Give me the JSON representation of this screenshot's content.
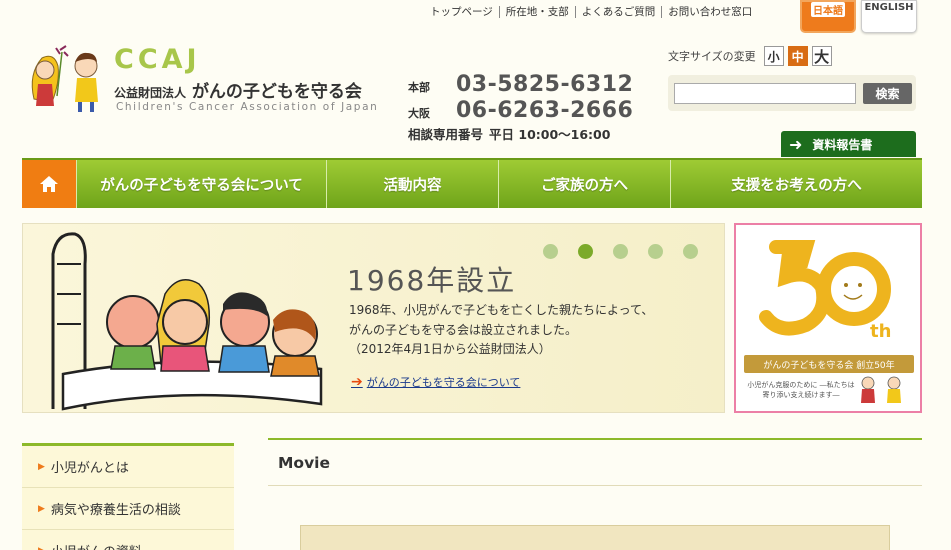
{
  "toplinks": [
    "トップページ",
    "所在地・支部",
    "よくあるご質問",
    "お問い合わせ窓口"
  ],
  "lang": {
    "ja": "日本語",
    "en": "ENGLISH"
  },
  "logo": {
    "ccaj": "CCAJ",
    "org_prefix": "公益財団法人",
    "org_name": "がんの子どもを守る会",
    "english": "Children's Cancer Association of Japan"
  },
  "phones": [
    {
      "label": "本部",
      "number": "03-5825-6312"
    },
    {
      "label": "大阪",
      "number": "06-6263-2666"
    }
  ],
  "hotline": {
    "label": "相談専用番号",
    "hours": "平日 10:00〜16:00"
  },
  "font_size": {
    "label": "文字サイズの変更",
    "small": "小",
    "medium": "中",
    "large": "大"
  },
  "search": {
    "button": "検索",
    "placeholder": ""
  },
  "report_button": "資料報告書",
  "nav": [
    "がんの子どもを守る会について",
    "活動内容",
    "ご家族の方へ",
    "支援をお考えの方へ"
  ],
  "hero": {
    "title": "1968年設立",
    "lines": [
      "1968年、小児がんで子どもを亡くした親たちによって、",
      "がんの子どもを守る会は設立されました。",
      "（2012年4月1日から公益財団法人）"
    ],
    "link": "がんの子どもを守る会について",
    "slides_total": 5,
    "slide_active": 2
  },
  "banner50": {
    "caption": "がんの子どもを守る会 創立50年",
    "sub": "小児がん克服のために ―私たちは寄り添い支え続けます―"
  },
  "sidebar": [
    "小児がんとは",
    "病気や療養生活の相談",
    "小児がんの資料"
  ],
  "main": {
    "heading": "Movie"
  },
  "colors": {
    "green": "#8db92a",
    "orange": "#ee7b1c",
    "darkgreen": "#1d6d1d",
    "pink": "#ec7fa6"
  }
}
